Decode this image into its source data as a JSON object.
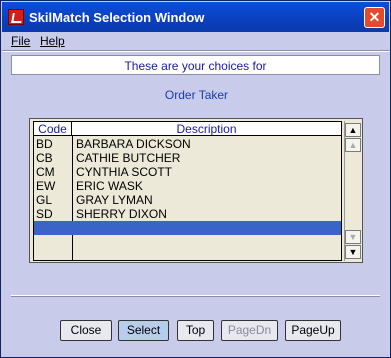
{
  "window": {
    "title": "SkilMatch Selection Window",
    "close_glyph": "✕"
  },
  "menu": {
    "file": "File",
    "help": "Help"
  },
  "header": {
    "text": "These are your choices for"
  },
  "mode_label": "Order Taker",
  "table": {
    "columns": [
      "Code",
      "Description"
    ],
    "rows": [
      {
        "code": "BD",
        "description": "BARBARA DICKSON"
      },
      {
        "code": "CB",
        "description": "CATHIE BUTCHER"
      },
      {
        "code": "CM",
        "description": "CYNTHIA SCOTT"
      },
      {
        "code": "EW",
        "description": "ERIC WASK"
      },
      {
        "code": "GL",
        "description": "GRAY LYMAN"
      },
      {
        "code": "SD",
        "description": "SHERRY DIXON"
      },
      {
        "code": "",
        "description": ""
      }
    ],
    "selected_row_index": 6,
    "selected_row_color": "#3a64c8"
  },
  "scrollbar": {
    "top_icon": "scroll-to-top-icon",
    "up_icon": "scroll-up-icon",
    "down_icon": "scroll-down-icon",
    "bottom_icon": "scroll-to-bottom-icon"
  },
  "buttons": {
    "close": "Close",
    "select": "Select",
    "top": "Top",
    "pagedn": "PageDn",
    "pageup": "PageUp"
  },
  "colors": {
    "title_bar": "#0a3fc0",
    "window_bg": "#c9cbeb",
    "header_text": "#1a1aa0"
  }
}
